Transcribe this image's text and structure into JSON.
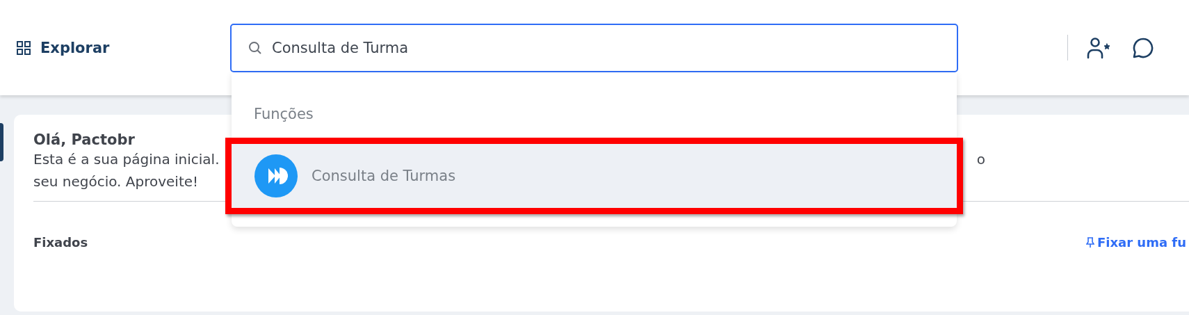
{
  "header": {
    "explore_label": "Explorar",
    "search": {
      "value": "Consulta de Turma"
    }
  },
  "dropdown": {
    "section_title": "Funções",
    "results": [
      {
        "label": "Consulta de Turmas",
        "selected": true,
        "highlighted": true
      }
    ]
  },
  "card": {
    "greeting": "Olá, Pactobr",
    "intro_lines": [
      "Esta é a sua página inicial.",
      "seu negócio. Aproveite!"
    ],
    "intro_tail": "o",
    "pinned_title": "Fixados",
    "pin_link": "Fixar uma fu"
  }
}
